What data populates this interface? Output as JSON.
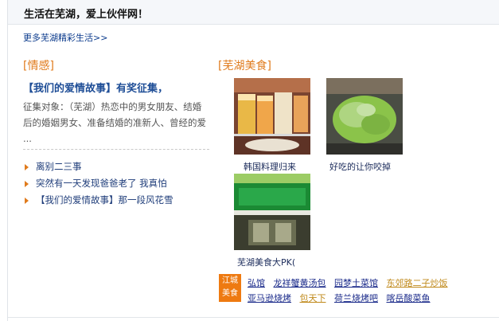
{
  "header": {
    "title": "生活在芜湖，爱上伙伴网！"
  },
  "more_link": "更多芜湖精彩生活>>",
  "love": {
    "title": "[情感]",
    "story_title": "【我们的爱情故事】有奖征集，",
    "story_desc": "征集对象：（芜湖）热恋中的男女朋友、结婚后的婚姻男女、准备结婚的准新人、曾经的爱 ...",
    "items": [
      {
        "label": "离别二三事"
      },
      {
        "label": "突然有一天发现爸爸老了 我真怕"
      },
      {
        "label": "【我们的爱情故事】那一段风花雪"
      }
    ]
  },
  "food": {
    "title": "[芜湖美食]",
    "photos": [
      {
        "caption": "韩国料理归来",
        "icon": "korean-drinks-photo"
      },
      {
        "caption": "好吃的让你咬掉",
        "icon": "lettuce-bbq-photo"
      },
      {
        "caption": "芜湖美食大PK(",
        "icon": "restaurant-storefront-photo"
      }
    ],
    "badge": "江城美食",
    "links": [
      {
        "label": "弘馆",
        "color": "#1a2a8a"
      },
      {
        "label": "龙祥蟹黄汤包",
        "color": "#1a2a8a"
      },
      {
        "label": "园梦土菜馆",
        "color": "#1a2a8a"
      },
      {
        "label": "东郊路二子炒饭",
        "color": "#c08a1c"
      },
      {
        "label": "亚马逊烧烤",
        "color": "#1a2a8a"
      },
      {
        "label": "包天下",
        "color": "#c08a1c"
      },
      {
        "label": "荷兰烧烤吧",
        "color": "#1a2a8a"
      },
      {
        "label": "喀岳酸菜鱼",
        "color": "#1a2a8a"
      }
    ]
  },
  "colors": {
    "accent": "#e07b1d",
    "link": "#1a2a8a",
    "badge": "#ee7a11"
  }
}
